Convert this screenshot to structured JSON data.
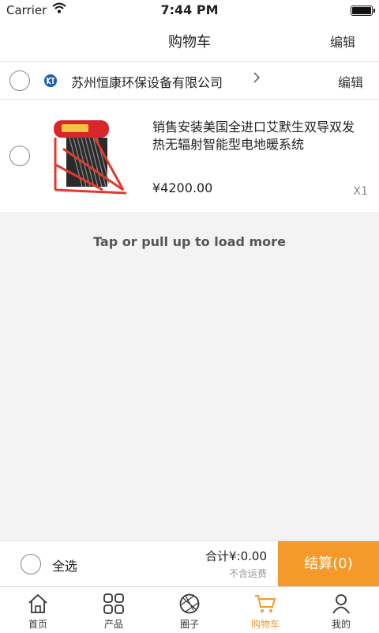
{
  "status_bar": {
    "carrier": "Carrier",
    "time": "7:44 PM"
  },
  "nav": {
    "title": "购物车",
    "edit_label": "编辑"
  },
  "shop": {
    "name": "苏州恒康环保设备有限公司",
    "logo_icon": "company-logo-icon",
    "edit_label": "编辑"
  },
  "item": {
    "title": "销售安装美国全进口艾默生双导双发热无辐射智能型电地暖系统",
    "price": "¥4200.00",
    "quantity": "X1"
  },
  "load_more": "Tap or pull up to load more",
  "checkout": {
    "select_all_label": "全选",
    "total_label": "合计¥:0.00",
    "shipping_note": "不含运费",
    "button_label": "结算(0)"
  },
  "tabbar": {
    "items": [
      {
        "label": "首页",
        "icon": "home-icon"
      },
      {
        "label": "产品",
        "icon": "grid-icon"
      },
      {
        "label": "圈子",
        "icon": "aperture-icon"
      },
      {
        "label": "购物车",
        "icon": "cart-icon",
        "active": true
      },
      {
        "label": "我的",
        "icon": "person-icon"
      }
    ]
  },
  "colors": {
    "accent": "#f39a2b",
    "background": "#f3f3f3"
  }
}
